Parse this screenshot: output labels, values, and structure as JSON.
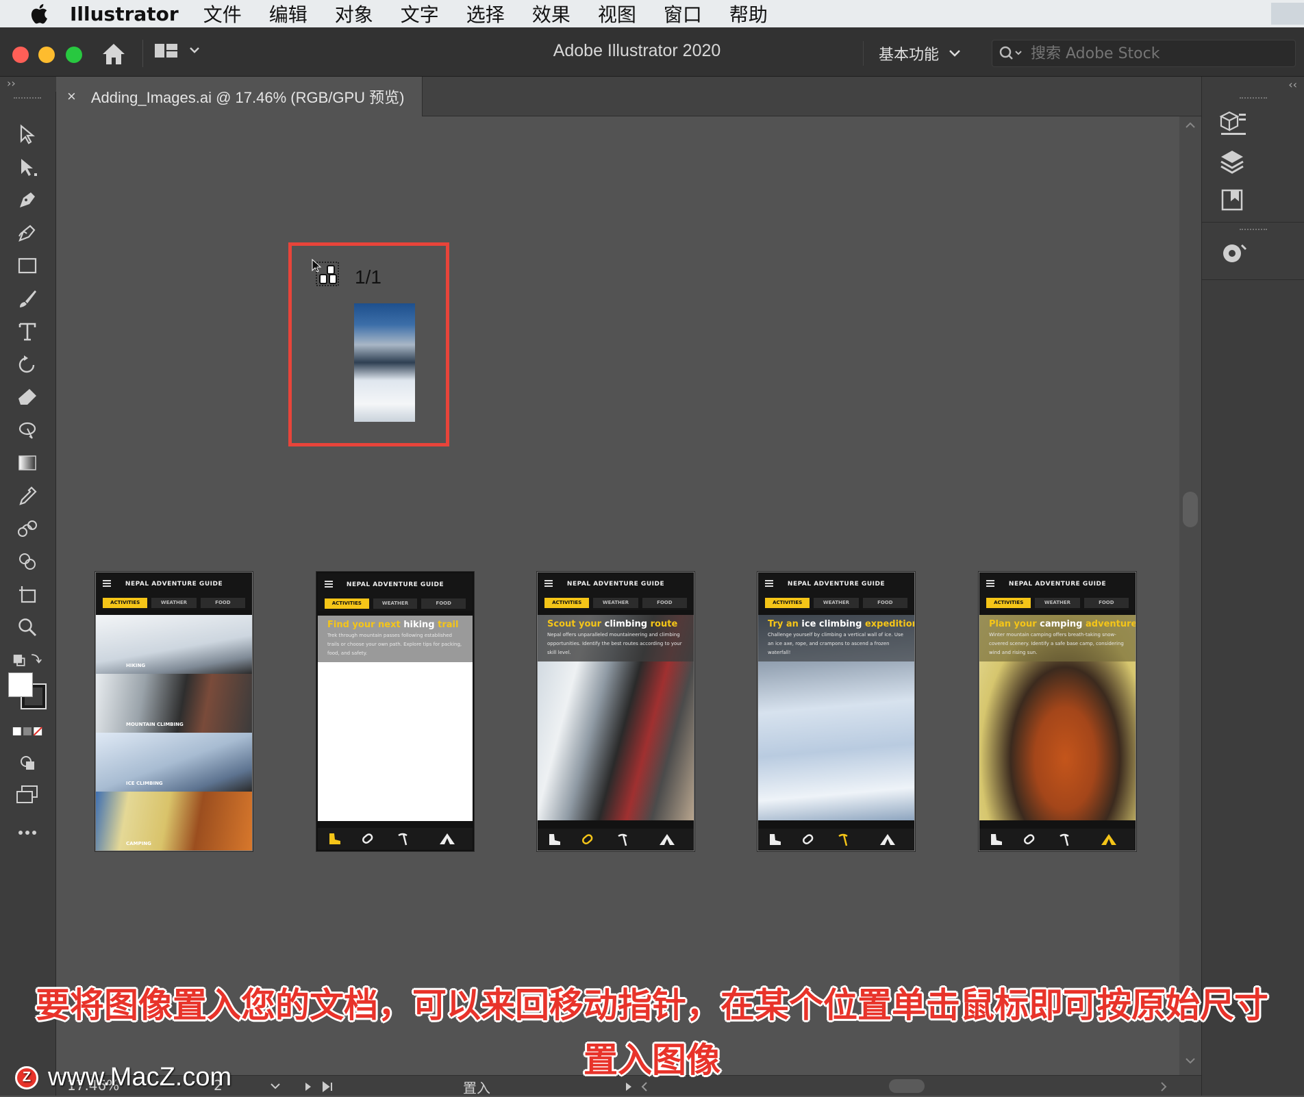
{
  "menubar": {
    "app_name": "Illustrator",
    "items": [
      "文件",
      "编辑",
      "对象",
      "文字",
      "选择",
      "效果",
      "视图",
      "窗口",
      "帮助"
    ]
  },
  "titlebar": {
    "title": "Adobe Illustrator 2020",
    "workspace": "基本功能",
    "search_placeholder": "搜索 Adobe Stock"
  },
  "document_tab": {
    "label": "Adding_Images.ai @ 17.46% (RGB/GPU 预览)",
    "close": "×"
  },
  "place_cursor": {
    "count": "1/1"
  },
  "app_header_title": "NEPAL ADVENTURE GUIDE",
  "app_tabs": [
    "ACTIVITIES",
    "WEATHER",
    "FOOD"
  ],
  "artboards": [
    {
      "sections": [
        "HIKING",
        "MOUNTAIN CLIMBING",
        "ICE CLIMBING",
        "CAMPING"
      ]
    },
    {
      "heading_plain": "Find your next",
      "heading_bold": "hiking",
      "heading_tail": "trail",
      "body": "Trek through mountain passes following established trails or choose your own path. Explore tips for packing, food, and safety."
    },
    {
      "heading_plain": "Scout your",
      "heading_bold": "climbing",
      "heading_tail": "route",
      "body": "Nepal offers unparalleled mountaineering and climbing opportunities. Identify the best routes according to your skill level."
    },
    {
      "heading_plain": "Try an",
      "heading_bold": "ice climbing",
      "heading_tail": "expedition",
      "body": "Challenge yourself by climbing a vertical wall of ice. Use an ice axe, rope, and crampons to ascend a frozen waterfall!"
    },
    {
      "heading_plain": "Plan your",
      "heading_bold": "camping",
      "heading_tail": "adventure",
      "body": "Winter mountain camping offers breath-taking snow-covered scenery. Identify a safe base camp, considering wind and rising sun."
    }
  ],
  "statusbar": {
    "zoom": "17.46%",
    "artboard_number": "2",
    "tool_name": "置入"
  },
  "caption": {
    "line1": "要将图像置入您的文档，可以来回移动指针，在某个位置单击鼠标即可按原始尺寸",
    "line2": "置入图像"
  },
  "watermark": {
    "logo": "Z",
    "text": "www.MacZ.com"
  },
  "colors": {
    "accent_yellow": "#f5c518",
    "highlight_red": "#e8443a",
    "canvas_gray": "#535353"
  }
}
